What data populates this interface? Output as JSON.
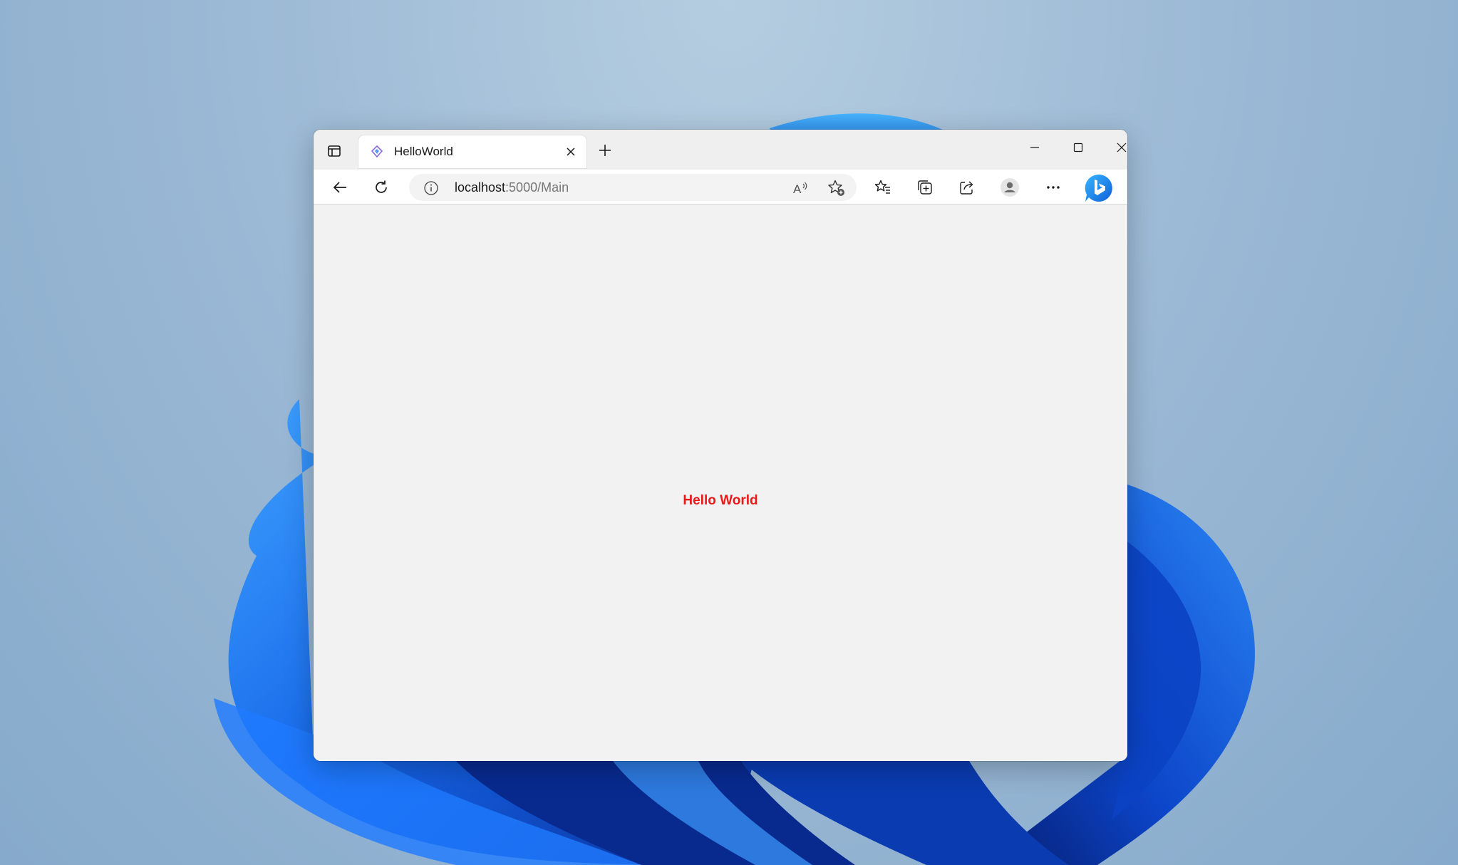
{
  "browser": {
    "tab": {
      "title": "HelloWorld",
      "favicon": "blazor-icon"
    },
    "address_bar": {
      "url_host": "localhost",
      "url_rest": ":5000/Main"
    },
    "window_controls": [
      "minimize-icon",
      "maximize-icon",
      "close-icon"
    ],
    "toolbar_icons": [
      "back-icon",
      "refresh-icon",
      "info-icon",
      "read-aloud-icon",
      "add-favorite-icon",
      "favorites-icon",
      "collections-icon",
      "share-icon",
      "profile-icon",
      "more-icon",
      "bing-copilot-icon"
    ]
  },
  "page": {
    "message": "Hello World",
    "message_color": "#e8191b"
  },
  "colors": {
    "accent": "#0f6cbd",
    "window_bg": "#f2f2f2"
  }
}
